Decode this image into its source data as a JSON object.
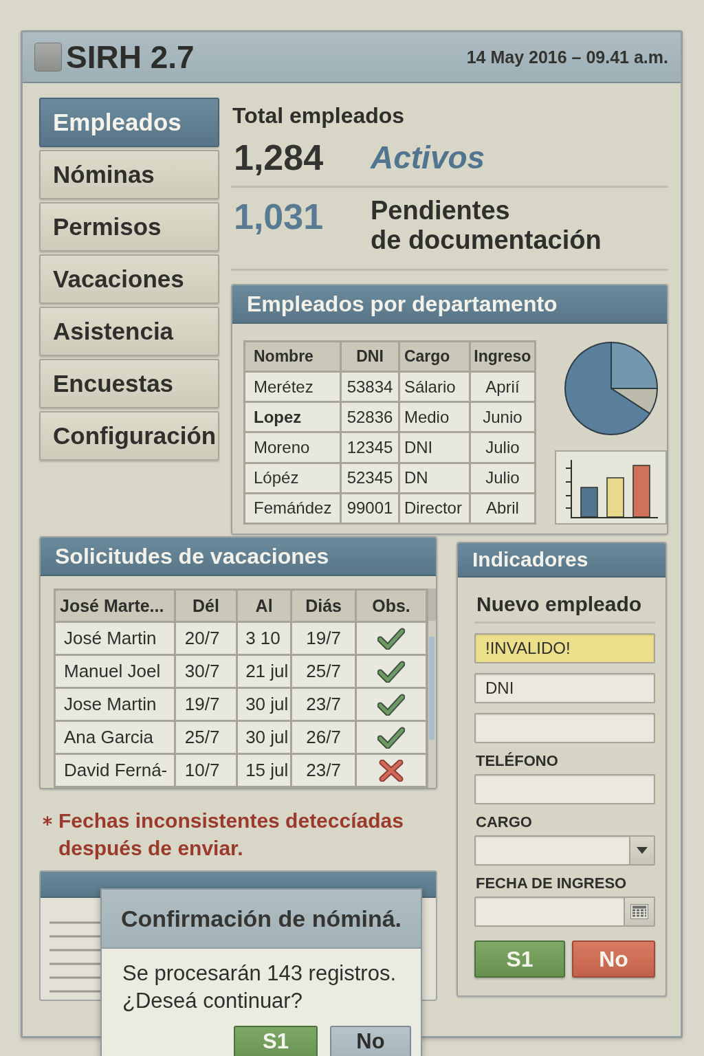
{
  "window": {
    "title": "SIRH 2.7",
    "datetime": "14 May 2016 – 09.41 a.m."
  },
  "sidebar": {
    "items": [
      {
        "label": "Empleados",
        "selected": true
      },
      {
        "label": "Nóminas",
        "selected": false
      },
      {
        "label": "Permisos",
        "selected": false
      },
      {
        "label": "Vacaciones",
        "selected": false
      },
      {
        "label": "Asistencia",
        "selected": false
      },
      {
        "label": "Encuestas",
        "selected": false
      },
      {
        "label": "Configuración",
        "selected": false
      }
    ]
  },
  "summary": {
    "title": "Total empleados",
    "rows": [
      {
        "kind": "active",
        "value": "1,284",
        "label": "Activos"
      },
      {
        "kind": "pending",
        "value": "1,031",
        "label": "Pendientes\nde documentación"
      }
    ]
  },
  "departments": {
    "title": "Empleados por departamento",
    "table": {
      "columns": [
        "Nombre",
        "DNI",
        "Cargo",
        "Ingreso"
      ],
      "rows": [
        {
          "selected": false,
          "cells": [
            "Merétez",
            "53834",
            "Sálario",
            "Aprií"
          ]
        },
        {
          "selected": true,
          "cells": [
            "Lopez",
            "52836",
            "Medio",
            "Junio"
          ]
        },
        {
          "selected": false,
          "cells": [
            "Moreno",
            "12345",
            "DNI",
            "Julio"
          ]
        },
        {
          "selected": false,
          "cells": [
            "Lópéz",
            "52345",
            "DN",
            "Julio"
          ]
        },
        {
          "selected": false,
          "cells": [
            "Femáńdez",
            "99001",
            "Director",
            "Abril"
          ]
        }
      ]
    }
  },
  "vacations": {
    "title": "Solicitudes de vacaciones",
    "table": {
      "columns": [
        "José Marte...",
        "Dél",
        "Al",
        "Diás",
        "Obs."
      ],
      "rows": [
        {
          "cells": [
            "José Martin",
            "20/7",
            "3 10",
            "19/7"
          ],
          "approved": true
        },
        {
          "cells": [
            "Manuel Joel",
            "30/7",
            "21 jul",
            "25/7"
          ],
          "approved": true
        },
        {
          "cells": [
            "Jose Martin",
            "19/7",
            "30 jul",
            "23/7"
          ],
          "approved": true
        },
        {
          "cells": [
            "Ana Garcia",
            "25/7",
            "30 jul",
            "26/7"
          ],
          "approved": true
        },
        {
          "cells": [
            "David Ferná-",
            "10/7",
            "15 jul",
            "23/7"
          ],
          "approved": false
        }
      ]
    }
  },
  "warning": {
    "text": "Fechas inconsistentes deteccíadas después de enviar."
  },
  "indicators": {
    "title": "Indicadores",
    "form": {
      "title": "Nuevo empleado",
      "fields": [
        {
          "kind": "text",
          "value": "!INVALIDO!",
          "invalid": true
        },
        {
          "kind": "text",
          "placeholder": "DNI",
          "invalid": false
        },
        {
          "kind": "text",
          "invalid": false
        },
        {
          "kind": "text",
          "label": "TELÉFONO",
          "invalid": false
        },
        {
          "kind": "select",
          "label": "CARGO",
          "invalid": false
        },
        {
          "kind": "date",
          "label": "FECHA DE INGRESO",
          "invalid": false
        }
      ],
      "buttons": [
        {
          "label": "S1",
          "kind": "confirm"
        },
        {
          "label": "No",
          "kind": "cancel"
        }
      ]
    }
  },
  "dialog": {
    "title": "Confirmación de nóminá.",
    "message": "Se procesarán 143 registros.\n¿Deseá continuar?",
    "buttons": [
      {
        "label": "S1",
        "kind": "confirm"
      },
      {
        "label": "No",
        "kind": "neutral"
      }
    ]
  }
}
